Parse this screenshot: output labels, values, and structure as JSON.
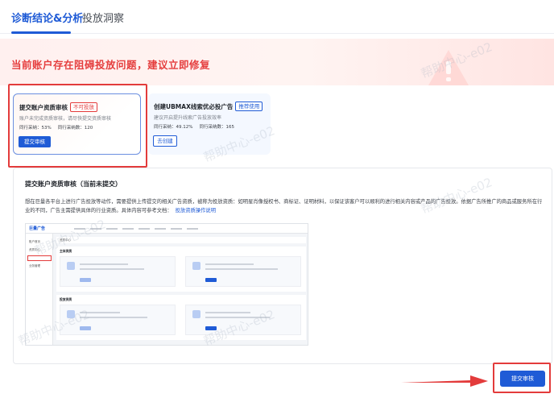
{
  "tabs": [
    {
      "label": "诊断结论&分析",
      "active": true
    },
    {
      "label": "投放洞察",
      "active": false
    }
  ],
  "banner": {
    "title": "当前账户存在阻碍投放问题，建议立即修复"
  },
  "cards": [
    {
      "title": "提交账户资质审核",
      "tag": "不可投放",
      "desc": "账户未完成资质审核，请尽快提交资质审核",
      "stats": [
        "同行采纳：53%",
        "同行采纳数：120"
      ],
      "button": "提交审核"
    },
    {
      "title": "创建UBMAX线索优必投广告",
      "tag": "推荐使用",
      "desc": "建议开启提升线索广告投放效率",
      "stats": [
        "同行采纳：49.12%",
        "同行采纳数：165"
      ],
      "button": "去创建"
    }
  ],
  "panel": {
    "title": "提交账户资质审核（当前未提交）",
    "desc": "想在巨量各平台上进行广告投放等动作，需要提供上传提交的相关广告资质，被称为投放资质：如明星肖像授权书、商标证、证明材料，以保证该客户可以顺利的进行相关内容或产品的广告投放。依据广告所推广的商品或服务所在行业的不同，广告主需提供具体的行业资质。具体内容可参考文档：",
    "link": "投放资质操作说明"
  },
  "mini": {
    "logo": "巨量广告",
    "side_items": [
      "账户首页",
      "资质中心",
      "业务管理"
    ],
    "head": "资质中心",
    "sections": [
      "主体资质",
      "投放资质"
    ]
  },
  "submit": {
    "label": "提交审核"
  },
  "watermark": "帮助中心-e02",
  "colors": {
    "primary": "#1f5bd6",
    "danger": "#e33b3b"
  }
}
